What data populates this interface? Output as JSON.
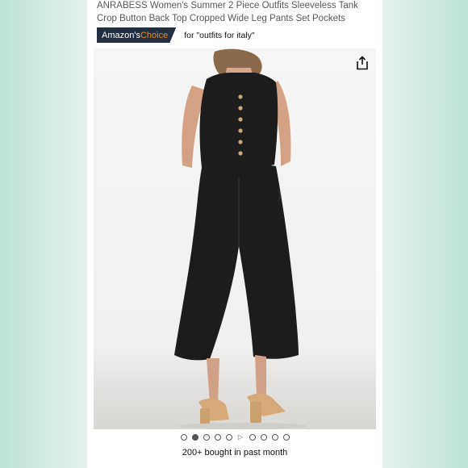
{
  "product": {
    "title": "ANRABESS Women's Summer 2 Piece Outfits Sleeveless Tank Crop Button Back Top Cropped Wide Leg Pants Set Pockets"
  },
  "badge": {
    "prefix": "Amazon's ",
    "accent": "Choice",
    "for_text": "for \"outfits for italy\""
  },
  "icons": {
    "share": "share-icon",
    "heart": "heart-icon"
  },
  "carousel": {
    "total_slides": 10,
    "active_index": 1,
    "video_index": 5
  },
  "social_proof": "200+ bought in past month",
  "colors": {
    "badge_bg": "#232f3e",
    "badge_accent": "#f08804",
    "outfit": "#1c1c1c",
    "sandals": "#d7a878"
  }
}
